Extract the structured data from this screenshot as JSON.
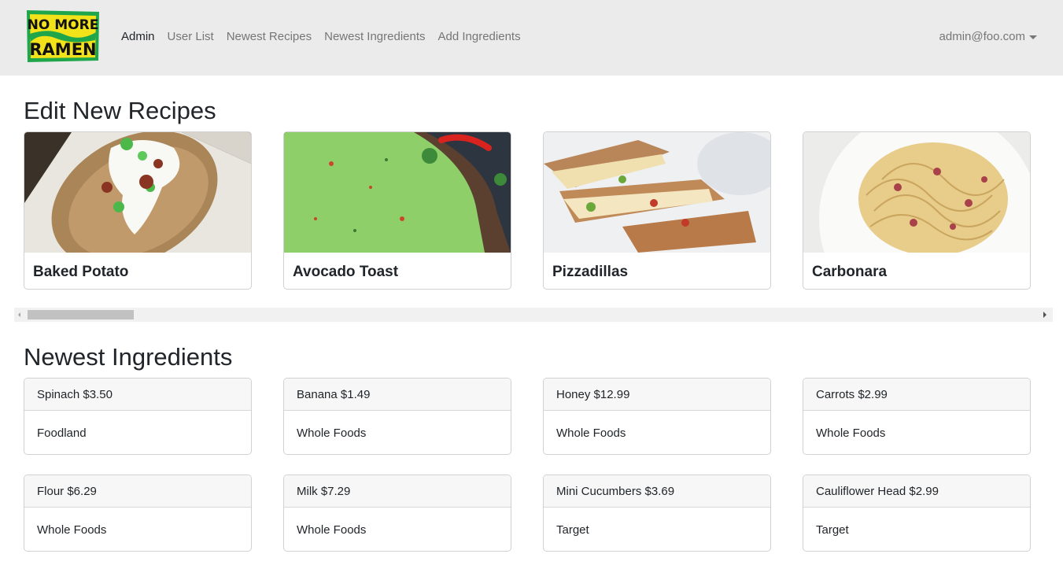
{
  "logo": {
    "line1": "NO MORE",
    "line2": "RAMEN"
  },
  "nav": {
    "items": [
      {
        "label": "Admin"
      },
      {
        "label": "User List"
      },
      {
        "label": "Newest Recipes"
      },
      {
        "label": "Newest Ingredients"
      },
      {
        "label": "Add Ingredients"
      }
    ],
    "user_email": "admin@foo.com"
  },
  "recipes_section": {
    "title": "Edit New Recipes",
    "recipes": [
      {
        "name": "Baked Potato"
      },
      {
        "name": "Avocado Toast"
      },
      {
        "name": "Pizzadillas"
      },
      {
        "name": "Carbonara"
      }
    ]
  },
  "ingredients_section": {
    "title": "Newest Ingredients",
    "ingredients": [
      {
        "name_price": "Spinach $3.50",
        "store": "Foodland"
      },
      {
        "name_price": "Banana $1.49",
        "store": "Whole Foods"
      },
      {
        "name_price": "Honey $12.99",
        "store": "Whole Foods"
      },
      {
        "name_price": "Carrots $2.99",
        "store": "Whole Foods"
      },
      {
        "name_price": "Flour $6.29",
        "store": "Whole Foods"
      },
      {
        "name_price": "Milk $7.29",
        "store": "Whole Foods"
      },
      {
        "name_price": "Mini Cucumbers $3.69",
        "store": "Target"
      },
      {
        "name_price": "Cauliflower Head $2.99",
        "store": "Target"
      }
    ]
  },
  "colors": {
    "navbar_bg": "#ebebeb",
    "logo_green": "#1fa64a",
    "logo_yellow": "#f2e21a",
    "nav_muted": "#767676"
  }
}
